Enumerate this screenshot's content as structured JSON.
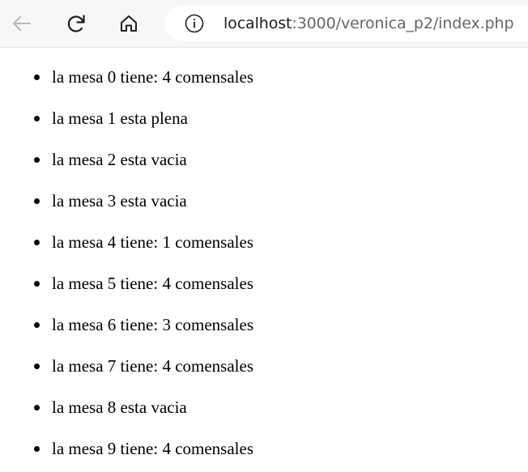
{
  "browser": {
    "back_icon": "back-arrow-icon",
    "reload_icon": "reload-icon",
    "home_icon": "home-icon",
    "site_info_icon": "info-icon",
    "url_host": "localhost",
    "url_path": ":3000/veronica_p2/index.php"
  },
  "colors": {
    "toolbar_bg": "#f7f7f7",
    "address_bg": "#ffffff",
    "text": "#000000"
  },
  "mesas": [
    "la mesa 0 tiene: 4 comensales",
    "la mesa 1 esta plena",
    "la mesa 2 esta vacia",
    "la mesa 3 esta vacia",
    "la mesa 4 tiene: 1 comensales",
    "la mesa 5 tiene: 4 comensales",
    "la mesa 6 tiene: 3 comensales",
    "la mesa 7 tiene: 4 comensales",
    "la mesa 8 esta vacia",
    "la mesa 9 tiene: 4 comensales"
  ]
}
